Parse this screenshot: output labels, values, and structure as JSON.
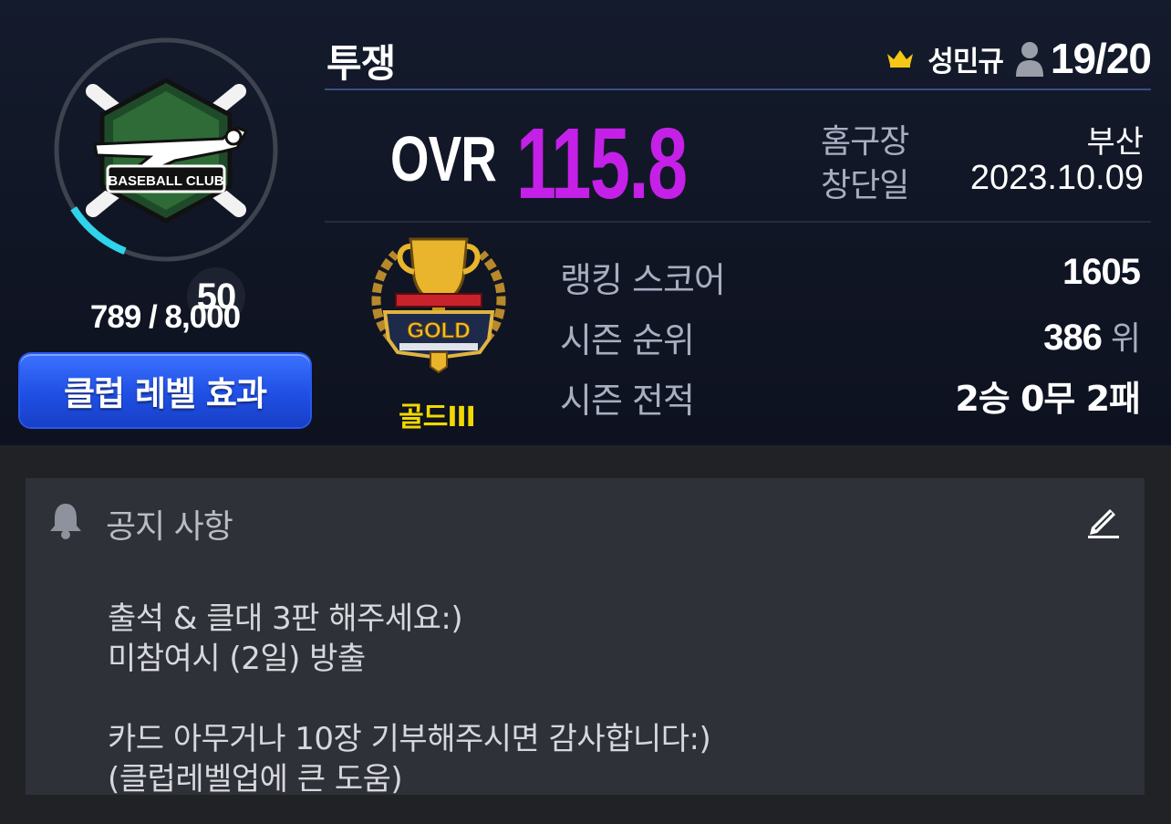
{
  "club": {
    "name": "투쟁",
    "leader_name": "성민규",
    "member_count": "19/20",
    "level": "50",
    "exp_text": "789 / 8,000",
    "exp_progress": 0.099,
    "emblem_text": "BASEBALL CLUB",
    "level_effect_label": "클럽 레벨 효과"
  },
  "stats": {
    "ovr_label": "OVR",
    "ovr_value": "115.8",
    "home_label": "홈구장",
    "home_value": "부산",
    "founded_label": "창단일",
    "founded_value": "2023.10.09"
  },
  "tier": {
    "name": "골드III",
    "badge_text": "GOLD",
    "ranking_label": "랭킹 스코어",
    "ranking_value": "1605",
    "season_rank_label": "시즌 순위",
    "season_rank_value": "386",
    "season_rank_unit": "위",
    "season_record_label": "시즌 전적",
    "season_record_value": "2승 0무 2패"
  },
  "notice": {
    "title": "공지 사항",
    "lines": [
      "출석 & 클대 3판 해주세요:)",
      "미참여시 (2일) 방출",
      "",
      "카드 아무거나 10장 기부해주시면 감사합니다:)",
      "(클럽레벨업에 큰 도움)"
    ]
  },
  "colors": {
    "ovr": "#c520e8",
    "tier": "#f2d800",
    "button": "#1f4fe4",
    "progress": "#2fd3ea"
  },
  "icons": {
    "crown": "crown-icon",
    "member": "person-icon",
    "bell": "bell-icon",
    "edit": "pencil-icon"
  }
}
